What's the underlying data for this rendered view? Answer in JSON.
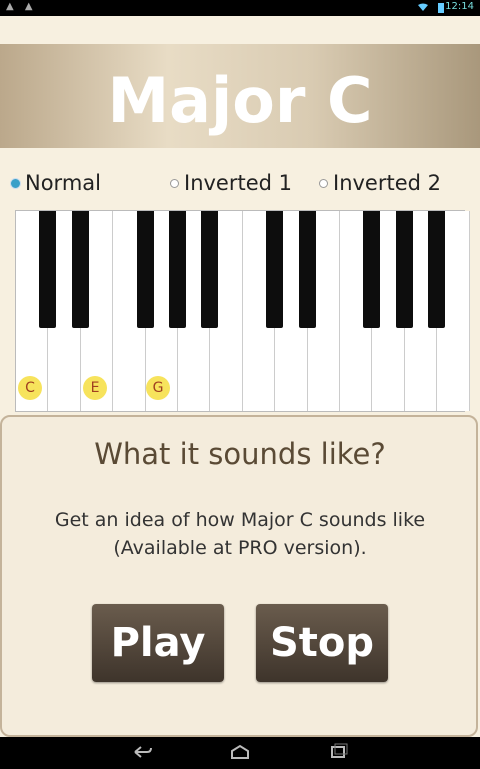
{
  "status_bar": {
    "left_icons": "▲ ▲",
    "time": "12:14"
  },
  "header": {
    "title": "Major C"
  },
  "chord_options": [
    {
      "label": "Normal",
      "selected": true
    },
    {
      "label": "Inverted 1",
      "selected": false
    },
    {
      "label": "Inverted 2",
      "selected": false
    }
  ],
  "keyboard": {
    "highlighted_notes": [
      "C",
      "E",
      "G"
    ]
  },
  "sound_panel": {
    "title": "What it sounds like?",
    "description_line1": "Get an idea of how Major C sounds like",
    "description_line2": "(Available at PRO version).",
    "play_label": "Play",
    "stop_label": "Stop"
  },
  "nav_bar": {
    "icons": [
      "back-icon",
      "home-icon",
      "recents-icon"
    ]
  },
  "colors": {
    "title_text": "#ffffff",
    "note_marker": "#f7e35c",
    "button_dark": "#3e342b",
    "radio_selected": "#3aa0c8"
  }
}
